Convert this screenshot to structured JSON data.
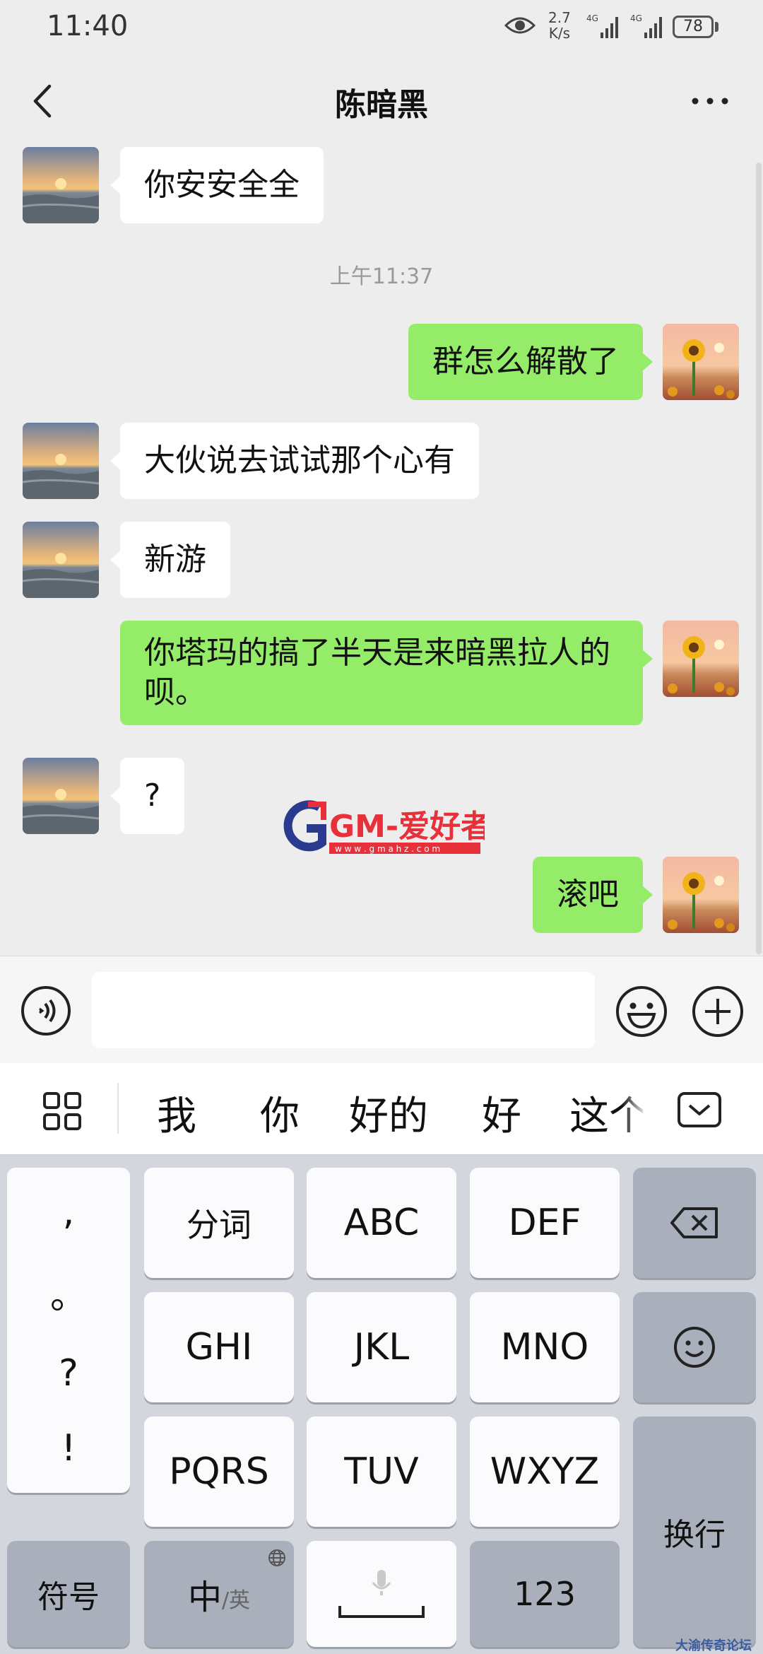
{
  "status_bar": {
    "time": "11:40",
    "net_speed_value": "2.7",
    "net_speed_unit": "K/s",
    "signal1_label": "4G",
    "signal2_label": "4G",
    "battery": "78"
  },
  "header": {
    "title": "陈暗黑"
  },
  "chat": {
    "messages": [
      {
        "side": "in",
        "text": "你安安全全"
      },
      {
        "side": "out",
        "text": "群怎么解散了"
      },
      {
        "side": "in",
        "text": "大伙说去试试那个心有"
      },
      {
        "side": "in",
        "text": "新游"
      },
      {
        "side": "out",
        "text": "你塔玛的搞了半天是来暗黑拉人的呗。"
      },
      {
        "side": "in",
        "text": "?"
      },
      {
        "side": "out",
        "text": "滚吧"
      }
    ],
    "timestamp": "上午11:37"
  },
  "watermark": {
    "brand": "GM-爱好者",
    "url": "w w w . g m a h z . c o m"
  },
  "input_bar": {
    "value": ""
  },
  "candidates": [
    "我",
    "你",
    "好的",
    "好",
    "这个"
  ],
  "keyboard": {
    "punct": [
      ",",
      "。",
      "?",
      "!"
    ],
    "row1": [
      "分词",
      "ABC",
      "DEF"
    ],
    "row2": [
      "GHI",
      "JKL",
      "MNO"
    ],
    "row3": [
      "PQRS",
      "TUV",
      "WXYZ"
    ],
    "symbols_label": "符号",
    "mode_main": "中",
    "mode_sub": "/英",
    "numbers_label": "123",
    "enter_label": "换行"
  },
  "site_mark": "大渝传奇论坛",
  "colors": {
    "background": "#ededed",
    "outgoing_bubble": "#95ec69",
    "incoming_bubble": "#ffffff",
    "watermark_red": "#e8303a",
    "watermark_blue": "#2a3b8f"
  }
}
